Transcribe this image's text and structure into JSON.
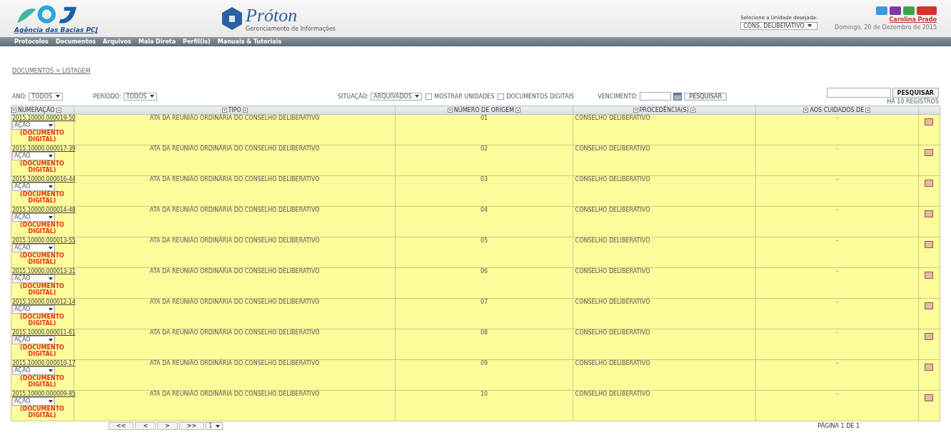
{
  "header": {
    "org": "Agência das Bacias PCJ",
    "app_title": "Próton",
    "app_subtitle": "Gerenciamento de Informações",
    "unit_label": "Selecione a Unidade desejada:",
    "unit_value": "CONS. DELIBERATIVO",
    "user": "Carolina Prado",
    "date": "Domingo, 20 de Dezembro de 2015"
  },
  "menu": [
    "Protocolos",
    "Documentos",
    "Arquivos",
    "Mala Direta",
    "Perfil(is)",
    "Manuais & Tutoriais"
  ],
  "breadcrumb": "DOCUMENTOS > LISTAGEM",
  "filters": {
    "year_label": "ANO:",
    "year": "TODOS",
    "period_label": "PERÍODO:",
    "period": "TODOS",
    "status_label": "SITUAÇÃO:",
    "status": "ARQUIVADOS",
    "show_units": {
      "label": "MOSTRAR UNIDADES",
      "checked": false
    },
    "digital_docs": {
      "label": "DOCUMENTOS DIGITAIS",
      "checked": false
    },
    "due_label": "VENCIMENTO:",
    "search_button": "PESQUISAR",
    "quick_search_button": "PESQUISAR",
    "count": "HÁ 10 REGISTROS"
  },
  "table": {
    "columns": [
      "NUMERAÇÃO",
      "TIPO",
      "NÚMERO DE ORIGEM",
      "PROCEDÊNCIA(S)",
      "AOS CUIDADOS DE"
    ],
    "rows": [
      {
        "number": "2015.10000.000019-50",
        "action": "AÇÃO",
        "badge": "(DOCUMENTO DIGITAL)",
        "type": "ATA DA REUNIÃO ORDINÁRIA DO CONSELHO DELIBERATIVO",
        "origin": "01",
        "from": "CONSELHO DELIBERATIVO",
        "care_of": "-"
      },
      {
        "number": "2015.10000.000017-39",
        "action": "AÇÃO",
        "badge": "(DOCUMENTO DIGITAL)",
        "type": "ATA DA REUNIÃO ORDINÁRIA DO CONSELHO DELIBERATIVO",
        "origin": "02",
        "from": "CONSELHO DELIBERATIVO",
        "care_of": "-"
      },
      {
        "number": "2015.10000.000016-44",
        "action": "AÇÃO",
        "badge": "(DOCUMENTO DIGITAL)",
        "type": "ATA DA REUNIÃO ORDINÁRIA DO CONSELHO DELIBERATIVO",
        "origin": "03",
        "from": "CONSELHO DELIBERATIVO",
        "care_of": "-"
      },
      {
        "number": "2015.10000.000014-48",
        "action": "AÇÃO",
        "badge": "(DOCUMENTO DIGITAL)",
        "type": "ATA DA REUNIÃO ORDINÁRIA DO CONSELHO DELIBERATIVO",
        "origin": "04",
        "from": "CONSELHO DELIBERATIVO",
        "care_of": "-"
      },
      {
        "number": "2015.10000.000013-55",
        "action": "AÇÃO",
        "badge": "(DOCUMENTO DIGITAL)",
        "type": "ATA DA REUNIÃO ORDINÁRIA DO CONSELHO DELIBERATIVO",
        "origin": "05",
        "from": "CONSELHO DELIBERATIVO",
        "care_of": "-"
      },
      {
        "number": "2015.10000.000013-31",
        "action": "AÇÃO",
        "badge": "(DOCUMENTO DIGITAL)",
        "type": "ATA DA REUNIÃO ORDINÁRIA DO CONSELHO DELIBERATIVO",
        "origin": "06",
        "from": "CONSELHO DELIBERATIVO",
        "care_of": "-"
      },
      {
        "number": "2015.10000.000012-14",
        "action": "AÇÃO",
        "badge": "(DOCUMENTO DIGITAL)",
        "type": "ATA DA REUNIÃO ORDINÁRIA DO CONSELHO DELIBERATIVO",
        "origin": "07",
        "from": "CONSELHO DELIBERATIVO",
        "care_of": "-"
      },
      {
        "number": "2015.10000.000011-61",
        "action": "AÇÃO",
        "badge": "(DOCUMENTO DIGITAL)",
        "type": "ATA DA REUNIÃO ORDINÁRIA DO CONSELHO DELIBERATIVO",
        "origin": "08",
        "from": "CONSELHO DELIBERATIVO",
        "care_of": "-"
      },
      {
        "number": "2015.10000.000010-17",
        "action": "AÇÃO",
        "badge": "(DOCUMENTO DIGITAL)",
        "type": "ATA DA REUNIÃO ORDINÁRIA DO CONSELHO DELIBERATIVO",
        "origin": "09",
        "from": "CONSELHO DELIBERATIVO",
        "care_of": "-"
      },
      {
        "number": "2015.10000.000009-85",
        "action": "AÇÃO",
        "badge": "(DOCUMENTO DIGITAL)",
        "type": "ATA DA REUNIÃO ORDINÁRIA DO CONSELHO DELIBERATIVO",
        "origin": "10",
        "from": "CONSELHO DELIBERATIVO",
        "care_of": "-"
      }
    ]
  },
  "pagination": {
    "buttons": [
      "<<",
      "<",
      ">",
      ">>"
    ],
    "page_select": "1",
    "info": "PÁGINA 1 DE 1"
  }
}
